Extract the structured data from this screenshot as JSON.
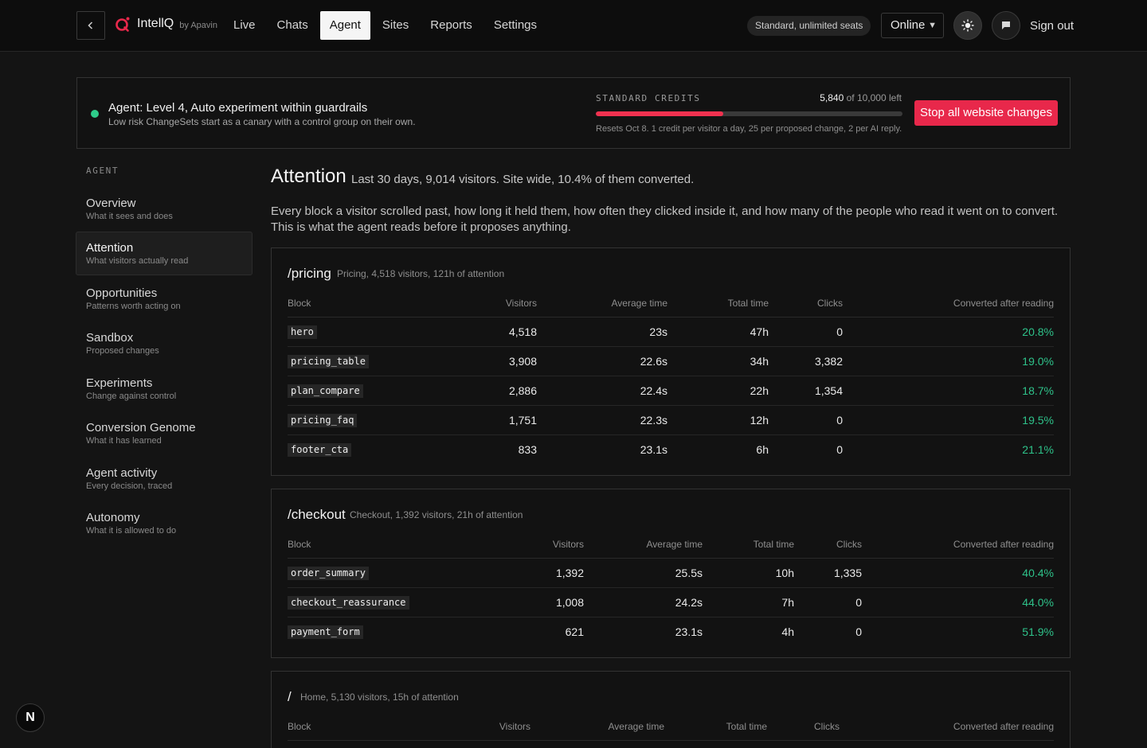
{
  "header": {
    "brand_name": "IntellQ",
    "brand_by": "by Apavin",
    "nav": [
      "Live",
      "Chats",
      "Agent",
      "Sites",
      "Reports",
      "Settings"
    ],
    "active_nav": "Agent",
    "plan_pill": "Standard, unlimited seats",
    "status": "Online",
    "sign_out": "Sign out"
  },
  "banner": {
    "agent_title": "Agent: Level 4, Auto experiment within guardrails",
    "agent_sub": "Low risk ChangeSets start as a canary with a control group on their own.",
    "credits_label": "STANDARD CREDITS",
    "credits_left": "5,840",
    "credits_of": " of 10,000 left",
    "credits_used_fraction": 0.416,
    "credits_note": "Resets Oct 8. 1 credit per visitor a day, 25 per proposed change, 2 per AI reply.",
    "stop_button": "Stop all website changes"
  },
  "sidebar": {
    "heading": "AGENT",
    "items": [
      {
        "label": "Overview",
        "desc": "What it sees and does"
      },
      {
        "label": "Attention",
        "desc": "What visitors actually read"
      },
      {
        "label": "Opportunities",
        "desc": "Patterns worth acting on"
      },
      {
        "label": "Sandbox",
        "desc": "Proposed changes"
      },
      {
        "label": "Experiments",
        "desc": "Change against control"
      },
      {
        "label": "Conversion Genome",
        "desc": "What it has learned"
      },
      {
        "label": "Agent activity",
        "desc": "Every decision, traced"
      },
      {
        "label": "Autonomy",
        "desc": "What it is allowed to do"
      }
    ]
  },
  "main": {
    "title": "Attention",
    "subtitle": "Last 30 days, 9,014 visitors. Site wide, 10.4% of them converted.",
    "description": "Every block a visitor scrolled past, how long it held them, how often they clicked inside it, and how many of the people who read it went on to convert. This is what the agent reads before it proposes anything.",
    "columns": [
      "Block",
      "Visitors",
      "Average time",
      "Total time",
      "Clicks",
      "Converted after reading"
    ],
    "cards": [
      {
        "path": "/pricing",
        "meta": "Pricing, 4,518 visitors, 121h of attention",
        "rows": [
          [
            "hero",
            "4,518",
            "23s",
            "47h",
            "0",
            "20.8%"
          ],
          [
            "pricing_table",
            "3,908",
            "22.6s",
            "34h",
            "3,382",
            "19.0%"
          ],
          [
            "plan_compare",
            "2,886",
            "22.4s",
            "22h",
            "1,354",
            "18.7%"
          ],
          [
            "pricing_faq",
            "1,751",
            "22.3s",
            "12h",
            "0",
            "19.5%"
          ],
          [
            "footer_cta",
            "833",
            "23.1s",
            "6h",
            "0",
            "21.1%"
          ]
        ]
      },
      {
        "path": "/checkout",
        "meta": "Checkout, 1,392 visitors, 21h of attention",
        "rows": [
          [
            "order_summary",
            "1,392",
            "25.5s",
            "10h",
            "1,335",
            "40.4%"
          ],
          [
            "checkout_reassurance",
            "1,008",
            "24.2s",
            "7h",
            "0",
            "44.0%"
          ],
          [
            "payment_form",
            "621",
            "23.1s",
            "4h",
            "0",
            "51.9%"
          ]
        ]
      },
      {
        "path": "/",
        "meta": "Home, 5,130 visitors, 15h of attention",
        "rows": []
      }
    ]
  },
  "badge": "N"
}
